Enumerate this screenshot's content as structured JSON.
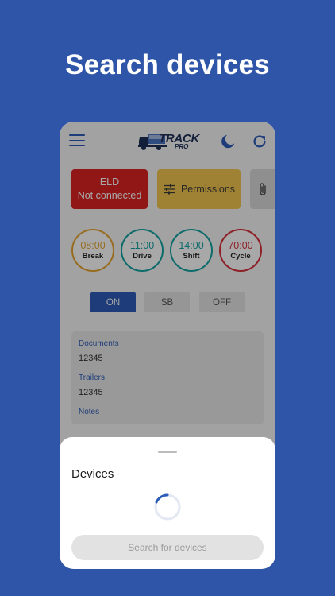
{
  "headline": "Search devices",
  "app": {
    "logo_main": "TRACK",
    "logo_sub": "PRO"
  },
  "eld_tile": {
    "line1": "ELD",
    "line2": "Not connected"
  },
  "permissions_tile": {
    "label": "Permissions"
  },
  "timers": [
    {
      "time": "08:00",
      "label": "Break",
      "color": "#e5a533"
    },
    {
      "time": "11:00",
      "label": "Drive",
      "color": "#15a3a3"
    },
    {
      "time": "14:00",
      "label": "Shift",
      "color": "#15a3a3"
    },
    {
      "time": "70:00",
      "label": "Cycle",
      "color": "#d6303c"
    }
  ],
  "status_toggle": [
    {
      "label": "ON",
      "active": true
    },
    {
      "label": "SB",
      "active": false
    },
    {
      "label": "OFF",
      "active": false
    }
  ],
  "info": {
    "documents_label": "Documents",
    "documents_value": "12345",
    "trailers_label": "Trailers",
    "trailers_value": "12345",
    "notes_label": "Notes"
  },
  "sheet": {
    "title": "Devices",
    "search_button": "Search for devices"
  },
  "colors": {
    "background": "#2f55a8",
    "accent": "#2c5bb8",
    "eld_red": "#dc2424",
    "permission_yellow": "#f3c64f"
  }
}
